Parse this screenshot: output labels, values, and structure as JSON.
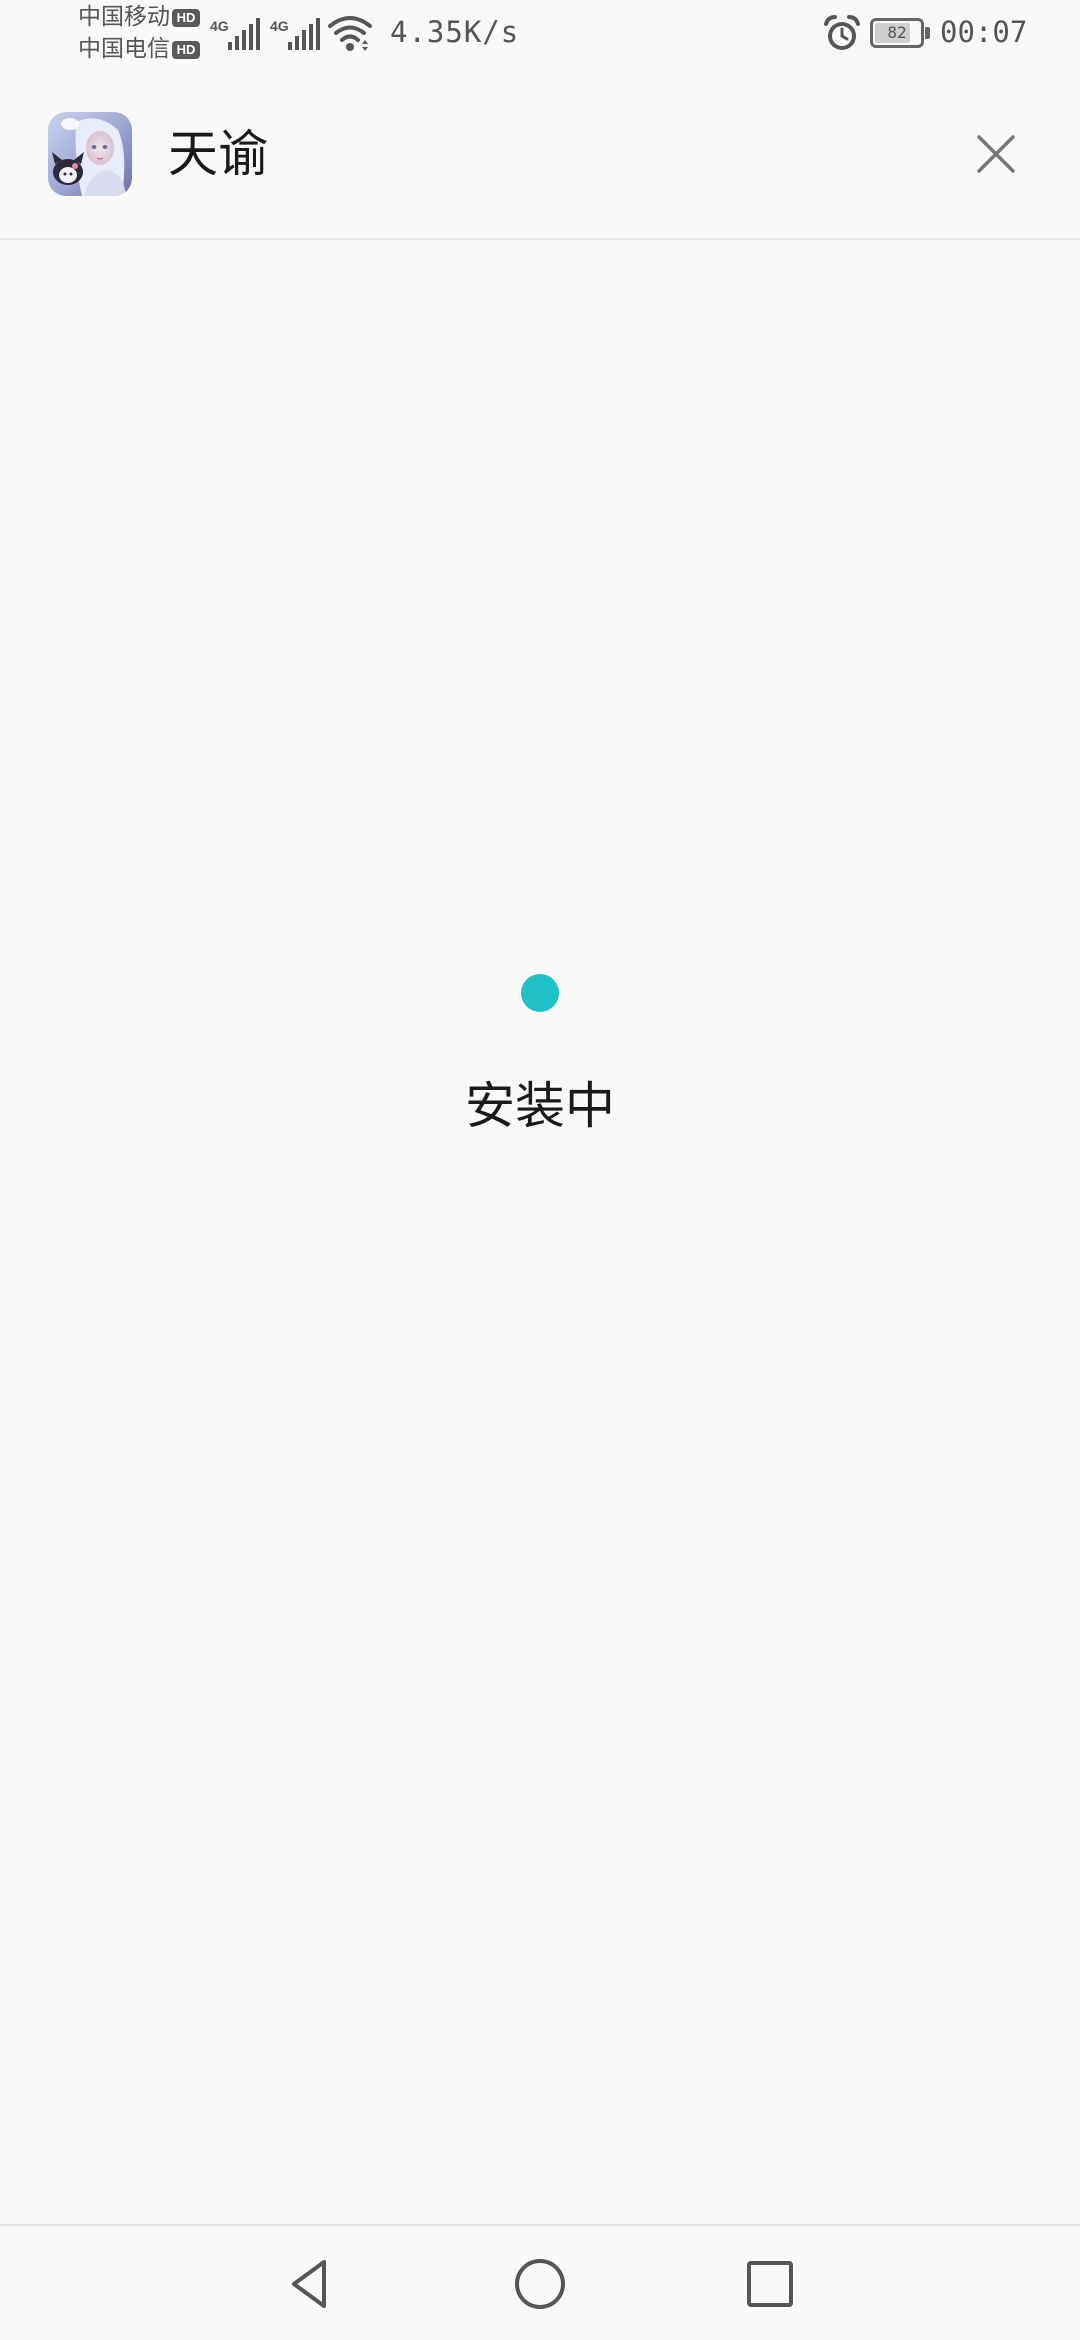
{
  "status_bar": {
    "carrier_1": "中国移动",
    "carrier_2": "中国电信",
    "hd_label": "HD",
    "network_type": "4G",
    "net_speed": "4.35K/s",
    "battery_level": "82",
    "battery_percent": 82,
    "time": "00:07",
    "icons": [
      "signal-icon",
      "wifi-icon",
      "alarm-icon",
      "battery-icon"
    ]
  },
  "header": {
    "app_name": "天谕",
    "close_icon": "close-icon"
  },
  "main": {
    "status_text": "安装中",
    "progress_color": "#1fc1c6"
  },
  "nav_bar": {
    "buttons": [
      "back-icon",
      "home-icon",
      "recents-icon"
    ]
  }
}
